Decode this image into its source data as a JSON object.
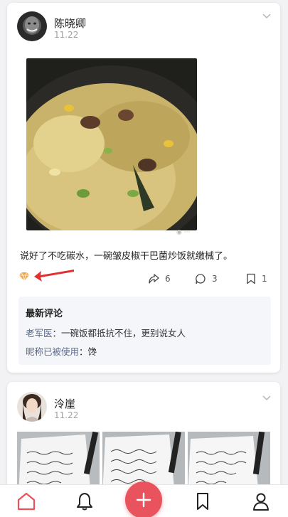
{
  "posts": [
    {
      "author": "陈晓卿",
      "date": "11.22",
      "text": "说好了不吃碳水，一碗皱皮椒干巴菌炒饭就缴械了。",
      "share_count": "6",
      "comment_count": "3",
      "bookmark_count": "1",
      "comments_title": "最新评论",
      "comments": [
        {
          "author": "老军医",
          "text": "：一碗饭都抵抗不住，更别说女人"
        },
        {
          "author": "昵称已被使用",
          "text": "：馋"
        }
      ]
    },
    {
      "author": "泠崖",
      "date": "11.22"
    }
  ],
  "colors": {
    "accent": "#e8535d",
    "link": "#5a6a8a",
    "gem": "#f0a64a"
  }
}
